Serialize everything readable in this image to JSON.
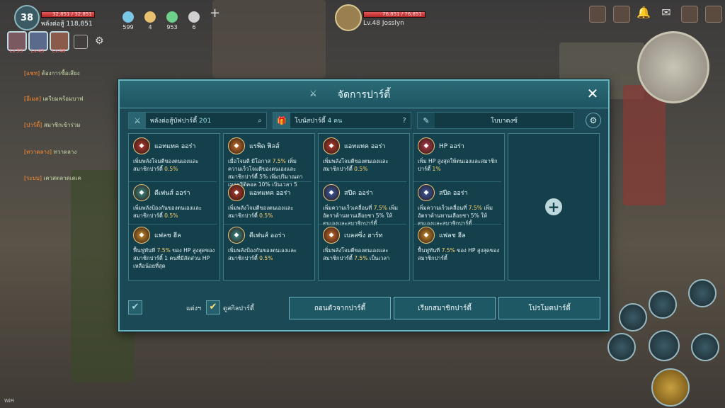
{
  "hud": {
    "level": "38",
    "hp_text": "32,851 / 32,851",
    "hp_fraction": 1.0,
    "power_label": "พลังต่อสู้ 118,851",
    "resources": [
      {
        "value": "599",
        "icon": "gem-icon",
        "color": "#7ac8e8"
      },
      {
        "value": "4",
        "icon": "ticket-icon",
        "color": "#e8c070"
      },
      {
        "value": "953",
        "icon": "stamina-icon",
        "color": "#6ed08a"
      },
      {
        "value": "6",
        "icon": "person-icon",
        "color": "#d0d0d0"
      }
    ],
    "party_levels": [
      "Lv.53",
      "Lv.43",
      "Lv.48"
    ],
    "target": {
      "hp_text": "76,851 / 76,851",
      "hp_fraction": 1.0,
      "name": "Lv.48  Josslyn"
    }
  },
  "chat": {
    "lines": [
      {
        "tag": "[แชท]",
        "text": "ต้องการซื้อเสียง"
      },
      {
        "tag": "[อีเมล]",
        "text": "เตรียมพร้อมบาฟ"
      },
      {
        "tag": "[ปาร์ตี้]",
        "text": "สมาชิกเข้าร่วม"
      },
      {
        "tag": "[ทวาดลาง]",
        "text": "ทวาดลาง"
      },
      {
        "tag": "[ระบบ]",
        "text": "เควสตลาดเดเค"
      }
    ]
  },
  "dialog": {
    "title": "จัดการปาร์ตี้",
    "close_label": "✕",
    "power_label": "พลังต่อสู้บัฟปาร์ตี้",
    "power_value": "201",
    "bonus_label": "โบนัสปาร์ตี้",
    "bonus_value": "4 คน",
    "help_label": "?",
    "buff_name": "โบบาตงซ์",
    "columns": [
      [
        {
          "name": "แอทแทค ออร่า",
          "icon": "attack-aura-icon",
          "color": "#b33a2e",
          "desc_a": "เพิ่มพลังโจมตีของตนเองและสมาชิกปาร์ตี้ ",
          "hl": "0.5%",
          "desc_b": ""
        },
        {
          "name": "ดีเฟนส์ ออร่า",
          "icon": "defense-aura-icon",
          "color": "#3b8a86",
          "desc_a": "เพิ่มพลังป้องกันของตนเองและสมาชิกปาร์ตี้ ",
          "hl": "0.5%",
          "desc_b": ""
        },
        {
          "name": "แฟลช ฮีล",
          "icon": "flash-heal-icon",
          "color": "#c88a2a",
          "desc_a": "ฟื้นฟูทันที ",
          "hl": "7.5%",
          "desc_b": " ของ HP สูงสุดของสมาชิกปาร์ตี้ 1 คนที่มีสัดส่วน HP เหลือน้อยที่สุด"
        }
      ],
      [
        {
          "name": "แรพิด ฟิลส์",
          "icon": "rapid-fill-icon",
          "color": "#c8702a",
          "desc_a": "เมื่อโจมตี มีโอกาส ",
          "hl": "7.5%",
          "desc_b": " เพิ่มความเร็วโจมตีของตนเองและสมาชิกปาร์ตี้ 5% เพิ่มปริมาณดาเมจคริติคอล 10% เป็นเวลา 5 วินาที"
        },
        {
          "name": "แอทแทค ออร่า",
          "icon": "attack-aura-icon",
          "color": "#b33a2e",
          "desc_a": "เพิ่มพลังโจมตีของตนเองและสมาชิกปาร์ตี้ ",
          "hl": "0.5%",
          "desc_b": ""
        },
        {
          "name": "ดีเฟนส์ ออร่า",
          "icon": "defense-aura-icon",
          "color": "#3b8a86",
          "desc_a": "เพิ่มพลังป้องกันของตนเองและสมาชิกปาร์ตี้ ",
          "hl": "0.5%",
          "desc_b": ""
        }
      ],
      [
        {
          "name": "แอทแทค ออร่า",
          "icon": "attack-aura-icon",
          "color": "#b33a2e",
          "desc_a": "เพิ่มพลังโจมตีของตนเองและสมาชิกปาร์ตี้ ",
          "hl": "0.5%",
          "desc_b": ""
        },
        {
          "name": "สปีด ออร่า",
          "icon": "speed-aura-icon",
          "color": "#3a5aa8",
          "desc_a": "เพิ่มความเร็วเคลื่อนที่ ",
          "hl": "7.5%",
          "desc_b": " เพิ่มอัตราต้านทานเลือยชา 5% ให้ตนเองและสมาชิกปาร์ตี้"
        },
        {
          "name": "เบลสซิ่ง ฮาร์ท",
          "icon": "blessing-heart-icon",
          "color": "#c86a2a",
          "desc_a": "เพิ่มพลังโจมตีของตนเองและสมาชิกปาร์ตี้ ",
          "hl": "7.5%",
          "desc_b": " เป็นเวลา"
        }
      ],
      [
        {
          "name": "HP ออร่า",
          "icon": "hp-aura-icon",
          "color": "#b33a4a",
          "desc_a": "เพิ่ม HP สูงสุดให้ตนเองและสมาชิกปาร์ตี้ ",
          "hl": "1%",
          "desc_b": ""
        },
        {
          "name": "สปีด ออร่า",
          "icon": "speed-aura-icon",
          "color": "#3a5aa8",
          "desc_a": "เพิ่มความเร็วเคลื่อนที่ ",
          "hl": "7.5%",
          "desc_b": " เพิ่มอัตราต้านทานเลือยชา 5% ให้ตนเองและสมาชิกปาร์ตี้"
        },
        {
          "name": "แฟลช ฮีล",
          "icon": "flash-heal-icon",
          "color": "#c88a2a",
          "desc_a": "ฟื้นฟูทันที ",
          "hl": "7.5%",
          "desc_b": " ของ HP สูงสุดของสมาชิกปาร์ตี้"
        }
      ]
    ],
    "footer": {
      "hide_label": "แต่งฯ",
      "view_skills_label": "ดูสกิลปาร์ตี้",
      "leave_button": "ถอนตัวจากปาร์ตี้",
      "call_button": "เรียกสมาชิกปาร์ตี้",
      "promote_button": "โปรโมตปาร์ตี้"
    }
  }
}
